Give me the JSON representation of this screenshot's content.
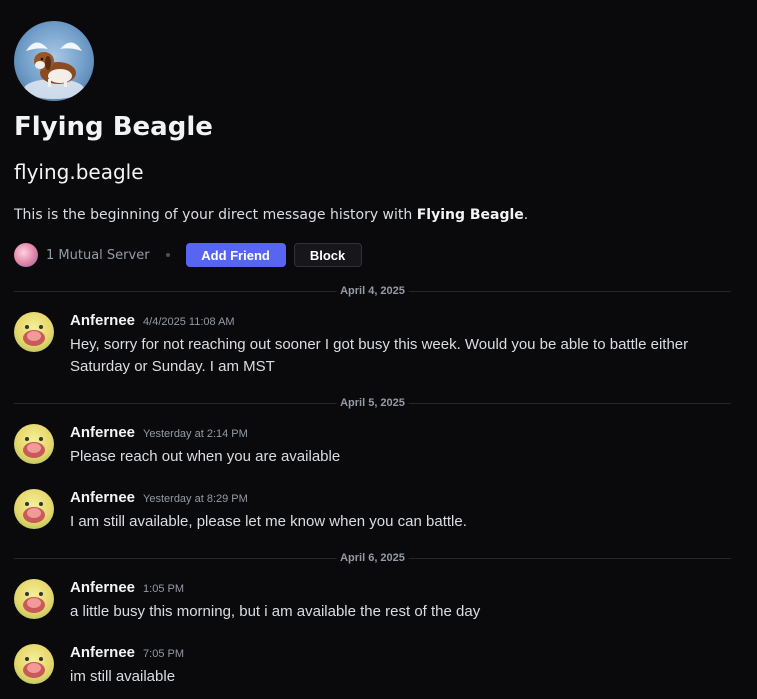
{
  "profile": {
    "display_name": "Flying Beagle",
    "username": "flying.beagle",
    "intro_prefix": "This is the beginning of your direct message history with ",
    "intro_name": "Flying Beagle",
    "intro_suffix": "."
  },
  "actions": {
    "mutual_servers": "1 Mutual Server",
    "add_friend": "Add Friend",
    "block": "Block"
  },
  "dividers": [
    "April 4, 2025",
    "April 5, 2025",
    "April 6, 2025"
  ],
  "messages": [
    {
      "author": "Anfernee",
      "time": "4/4/2025 11:08 AM",
      "text": "Hey, sorry for not reaching out sooner I got busy this week. Would you be able to battle either Saturday or Sunday. I am MST"
    },
    {
      "author": "Anfernee",
      "time": "Yesterday at 2:14 PM",
      "text": "Please reach out when you are available"
    },
    {
      "author": "Anfernee",
      "time": "Yesterday at 8:29 PM",
      "text": "I am still available, please let me know when you can battle."
    },
    {
      "author": "Anfernee",
      "time": "1:05 PM",
      "text": "a little busy this morning, but i am available the rest of the day"
    },
    {
      "author": "Anfernee",
      "time": "7:05 PM",
      "text": "im still available"
    }
  ],
  "colors": {
    "background": "#0a0a0d",
    "accent": "#5865f2",
    "text_muted": "#949ba4"
  }
}
